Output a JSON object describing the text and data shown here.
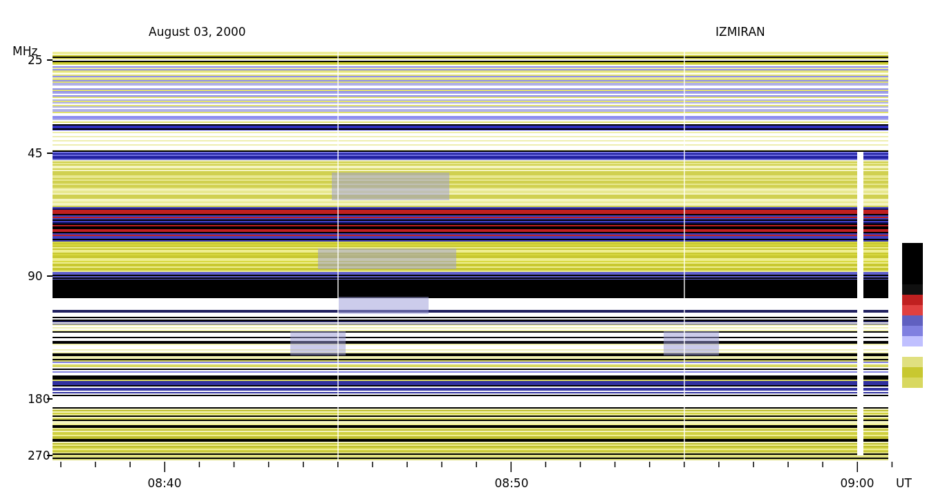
{
  "header": {
    "unit": "MHz",
    "date": "August 03, 2000",
    "observatory": "IZMIRAN"
  },
  "y_axis": {
    "labels": [
      "25",
      "45",
      "90",
      "180",
      "270"
    ]
  },
  "x_axis": {
    "labels": [
      "08:40",
      "08:50",
      "09:00"
    ],
    "unit": "UT"
  }
}
